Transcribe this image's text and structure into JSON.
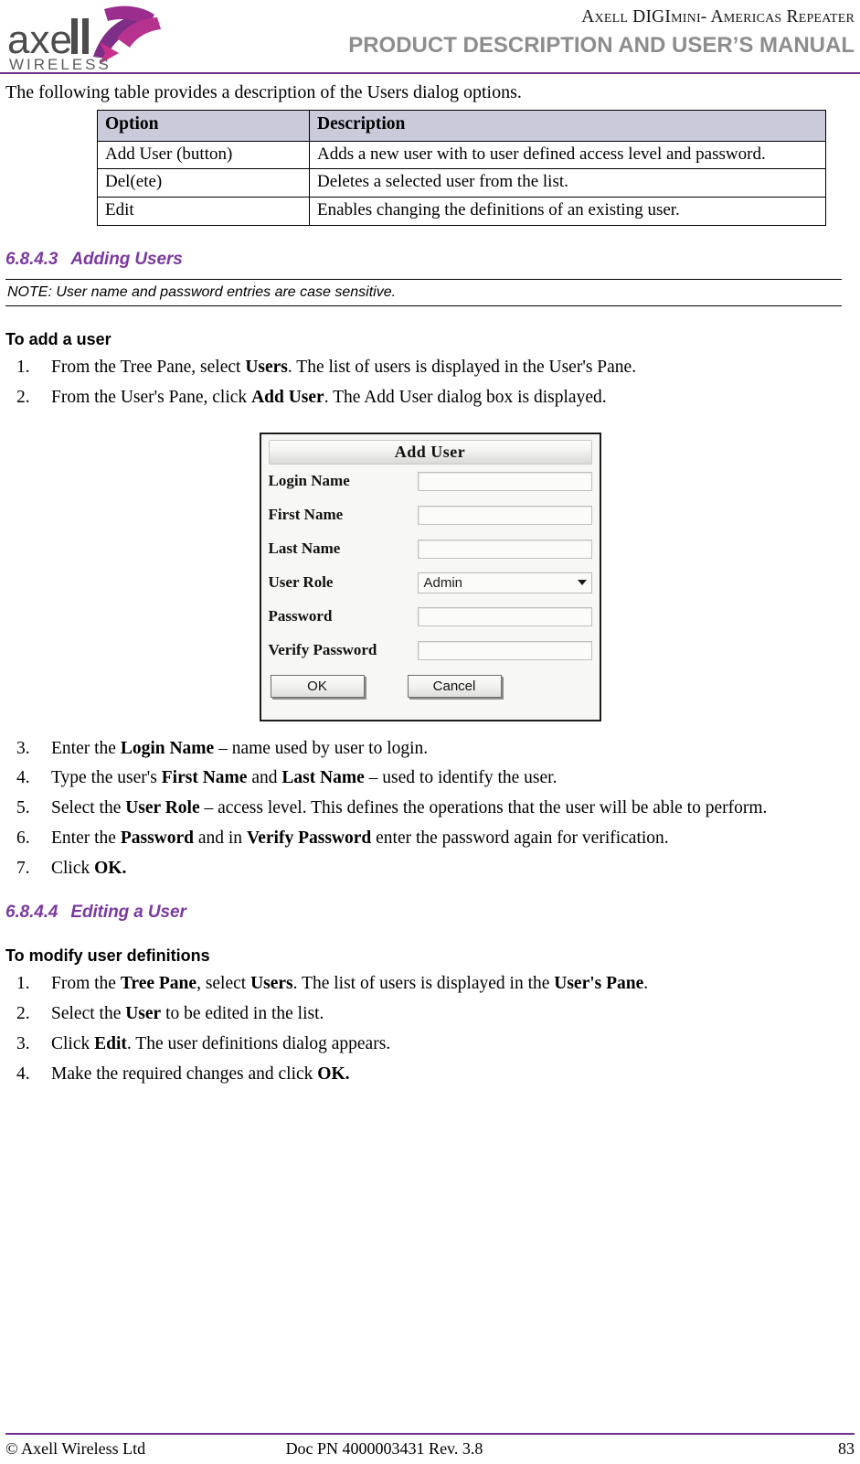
{
  "header": {
    "logo_text_main": "axell",
    "logo_text_sub": "WIRELESS",
    "title": "Axell DIGImini- Americas Repeater",
    "subtitle": "PRODUCT DESCRIPTION AND USER’S MANUAL",
    "rule_color": "#6f2f8e"
  },
  "intro_paragraph": "The following table provides a description of the Users dialog options.",
  "options_table": {
    "headers": [
      "Option",
      "Description"
    ],
    "header_bg": "#c9cada",
    "rows": [
      {
        "option": "Add User (button)",
        "description": "Adds a new user with to user defined access level and password."
      },
      {
        "option": "Del(ete)",
        "description": "Deletes a selected user from the list."
      },
      {
        "option": "Edit",
        "description": "Enables changing the definitions of an existing user."
      }
    ]
  },
  "section_adding": {
    "number": "6.8.4.3",
    "title": "Adding Users",
    "heading_color": "#7b3aa0",
    "note": "NOTE: User name and password entries are case sensitive.",
    "sub_heading": "To add a user",
    "steps": [
      {
        "marker": "1.",
        "html": "From the Tree Pane, select <b>Users</b>. The list of users is displayed in the User's Pane."
      },
      {
        "marker": "2.",
        "html": "From the User's Pane, click <b>Add User</b>. The Add User dialog box is displayed."
      },
      {
        "marker": "3.",
        "html": "Enter the <b>Login Name</b> – name used by user to login."
      },
      {
        "marker": "4.",
        "html": "Type the user's <b>First Name</b> and <b>Last Name</b> – used to identify the user."
      },
      {
        "marker": "5.",
        "html": "Select the <b>User Role</b> – access level. This defines the operations that the user will be able to perform."
      },
      {
        "marker": "6.",
        "html": "Enter the <b>Password</b> and in <b>Verify Password</b> enter the password again for verification."
      },
      {
        "marker": "7.",
        "html": "Click <b>OK.</b>"
      }
    ]
  },
  "add_user_dialog": {
    "title": "Add User",
    "fields": [
      {
        "label": "Login Name",
        "type": "text",
        "value": ""
      },
      {
        "label": "First Name",
        "type": "text",
        "value": ""
      },
      {
        "label": "Last Name",
        "type": "text",
        "value": ""
      },
      {
        "label": "User Role",
        "type": "select",
        "value": "Admin"
      },
      {
        "label": "Password",
        "type": "text",
        "value": ""
      },
      {
        "label": "Verify Password",
        "type": "text",
        "value": ""
      }
    ],
    "ok_label": "OK",
    "cancel_label": "Cancel"
  },
  "section_editing": {
    "number": "6.8.4.4",
    "title": "Editing a User",
    "heading_color": "#7b3aa0",
    "sub_heading": "To modify user definitions",
    "steps": [
      {
        "marker": "1.",
        "html": "From the <b>Tree Pane</b>, select <b>Users</b>. The list of users is displayed in the <b>User's Pane</b>."
      },
      {
        "marker": "2.",
        "html": "Select the <b>User</b> to be edited in the list."
      },
      {
        "marker": "3.",
        "html": "Click <b>Edit</b>. The user definitions dialog appears."
      },
      {
        "marker": "4.",
        "html": "Make the required changes and click <b>OK.</b>"
      }
    ]
  },
  "footer": {
    "left": "© Axell Wireless Ltd",
    "center": "Doc PN 4000003431 Rev. 3.8",
    "page_number": "83",
    "rule_color": "#6f2f8e"
  }
}
